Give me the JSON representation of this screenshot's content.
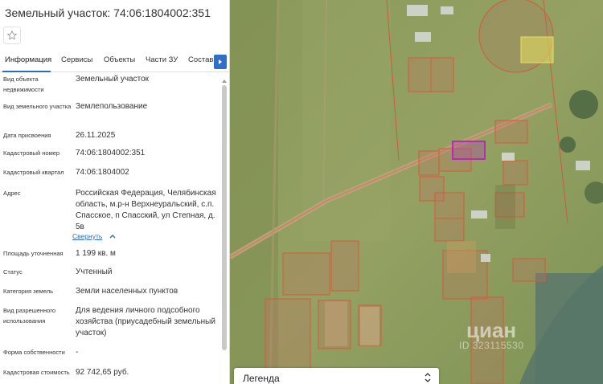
{
  "title": "Земельный участок: 74:06:1804002:351",
  "tabs": [
    "Информация",
    "Сервисы",
    "Объекты",
    "Части ЗУ",
    "Состав"
  ],
  "fields": [
    {
      "label": "Вид объекта недвижимости",
      "value": "Земельный участок"
    },
    {
      "label": "Вид земельного участка",
      "value": "Землепользование"
    },
    {
      "label": "Дата присвоения",
      "value": "26.11.2025"
    },
    {
      "label": "Кадастровый номер",
      "value": "74:06:1804002:351"
    },
    {
      "label": "Кадастровый квартал",
      "value": "74:06:1804002"
    },
    {
      "label": "Адрес",
      "value": "Российская Федерация, Челябинская область, м.р-н Верхнеуральский, с.п. Спасское, п Спасский, ул Степная, д. 5в"
    },
    {
      "label": "Площадь уточненная",
      "value": "1 199 кв. м"
    },
    {
      "label": "Статус",
      "value": "Учтенный"
    },
    {
      "label": "Категория земель",
      "value": "Земли населенных пунктов"
    },
    {
      "label": "Вид разрешенного использования",
      "value": "Для ведения личного подсобного хозяйства (приусадебный земельный участок)"
    },
    {
      "label": "Форма собственности",
      "value": "-"
    },
    {
      "label": "Кадастровая стоимость",
      "value": "92 742,65 руб."
    }
  ],
  "collapse_label": "Свернуть",
  "legend_title": "Легенда",
  "watermark": {
    "brand": "циан",
    "id": "ID 323115530"
  },
  "colors": {
    "accent": "#2b6cc4",
    "parcel_outline": "#d45a3a",
    "selected_parcel": "#b030b0",
    "highlight_parcel": "#e8e060"
  }
}
